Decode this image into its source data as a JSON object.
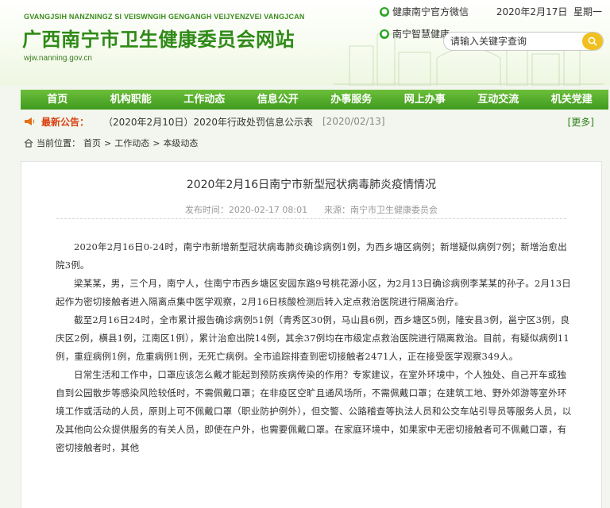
{
  "header": {
    "pinyin": "GVANGJSIH NANZNINGZ SI VEISWNGIH GENGANGH VEIJYENZVEI VANGJCAN",
    "site_title": "广西南宁市卫生健康委员会网站",
    "domain": "wjw.nanning.gov.cn",
    "wechat_label": "健康南宁官方微信",
    "smart_health_label": "南宁智慧健康",
    "date": "2020年2月17日",
    "weekday": "星期一",
    "search": {
      "placeholder": "请输入关键字查询"
    }
  },
  "nav": {
    "items": [
      "首页",
      "机构职能",
      "工作动态",
      "信息公开",
      "办事服务",
      "网上办事",
      "互动交流",
      "机关党建"
    ]
  },
  "notice": {
    "label": "最新公告：",
    "title": "（2020年2月10日）2020年行政处罚信息公示表",
    "date": "[2020/02/13]",
    "more": "[更多]"
  },
  "breadcrumb": {
    "label": "当前位置：",
    "items": [
      "首页",
      "工作动态",
      "本级动态"
    ],
    "sep": ">"
  },
  "article": {
    "title": "2020年2月16日南宁市新型冠状病毒肺炎疫情情况",
    "publish_label": "发布时间：",
    "publish_time": "2020-02-17 08:01",
    "source_label": "来源：",
    "source": "南宁市卫生健康委员会",
    "paragraphs": [
      "2020年2月16日0-24时，南宁市新增新型冠状病毒肺炎确诊病例1例，为西乡塘区病例；新增疑似病例7例；新增治愈出院3例。",
      "梁某某，男，三个月，南宁人，住南宁市西乡塘区安园东路9号桃花源小区，为2月13日确诊病例李某某的孙子。2月13日起作为密切接触者进入隔离点集中医学观察，2月16日核酸检测后转入定点救治医院进行隔离治疗。",
      "截至2月16日24时，全市累计报告确诊病例51例（青秀区30例，马山县6例，西乡塘区5例，隆安县3例，邕宁区3例，良庆区2例，横县1例，江南区1例），累计治愈出院14例，其余37例均在市级定点救治医院进行隔离救治。目前，有疑似病例11例，重症病例1例，危重病例1例，无死亡病例。全市追踪排查到密切接触者2471人，正在接受医学观察349人。",
      "日常生活和工作中，口罩应该怎么戴才能起到预防疾病传染的作用？专家建议，在室外环境中，个人独处、自己开车或独自到公园散步等感染风险较低时，不需佩戴口罩；在非疫区空旷且通风场所，不需佩戴口罩；在建筑工地、野外郊游等室外环境工作或活动的人员，原则上可不佩戴口罩（职业防护例外），但交警、公路稽查等执法人员和公交车站引导员等服务人员，以及其他向公众提供服务的有关人员，即使在户外，也需要佩戴口罩。在家庭环境中，如果家中无密切接触者可不佩戴口罩，有密切接触者时，其他"
    ]
  },
  "colors": {
    "brand_green": "#2f8a17",
    "nav_green": "#4fa825",
    "notice_red": "#d8400f",
    "search_yellow": "#f0c020"
  }
}
